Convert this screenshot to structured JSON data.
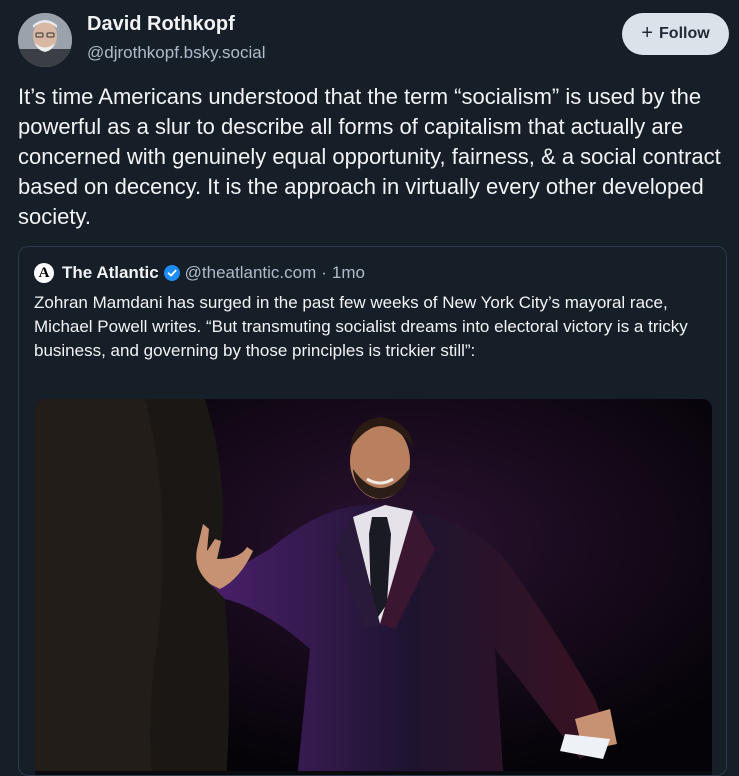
{
  "author": {
    "name": "David Rothkopf",
    "handle": "@djrothkopf.bsky.social"
  },
  "follow_button": {
    "label": "Follow",
    "icon": "plus-icon"
  },
  "post": {
    "text": "It’s time Americans understood that the term “socialism” is used by the powerful as a slur to describe all forms of capitalism that actually are concerned with genuinely equal opportunity, fairness, & a social contract based on decency. It is the approach in virtually every other developed society."
  },
  "quote": {
    "logo_letter": "A",
    "name": "The Atlantic",
    "verified_icon": "verified-badge-icon",
    "handle": "@theatlantic.com",
    "separator": "·",
    "time": "1mo",
    "text": "Zohran Mamdani has surged in the past few weeks of New York City’s mayoral race, Michael Powell writes. “But transmuting socialist dreams into electoral victory is a tricky business, and governing by those principles is trickier still”:"
  },
  "colors": {
    "background": "#161e27",
    "text_primary": "#f1f3f5",
    "text_secondary": "#aebbc9",
    "follow_bg": "#dce2ea",
    "verified": "#1d8cf5",
    "border": "#2c3a4a"
  }
}
